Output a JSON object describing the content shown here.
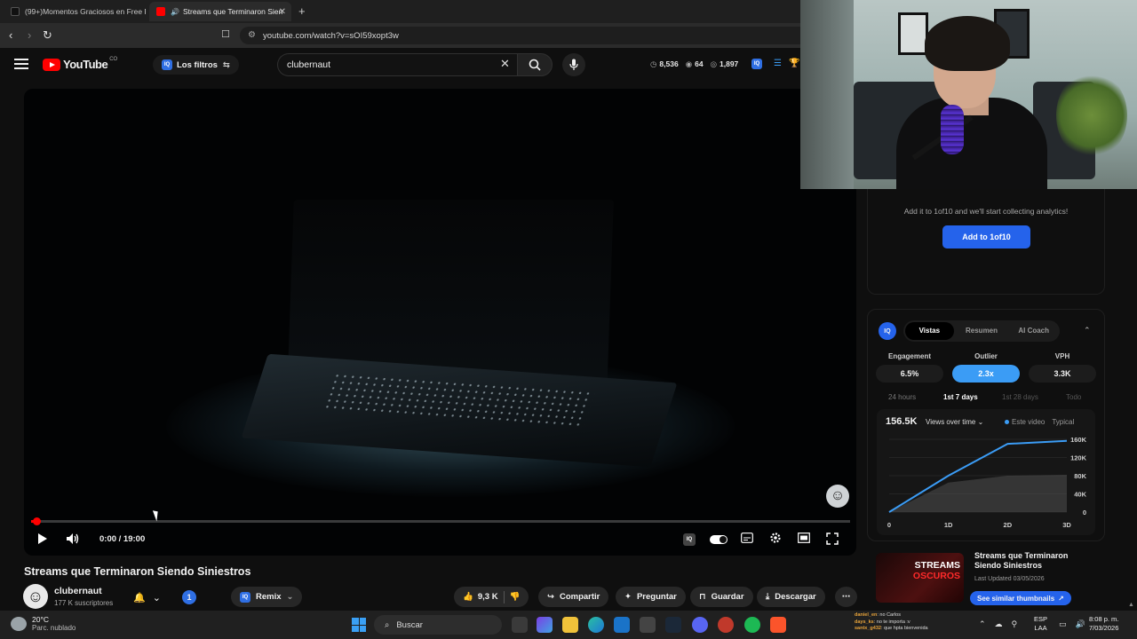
{
  "browser": {
    "tabs": [
      {
        "label": "(99+)Momentos Graciosos en Free F",
        "favicon": "tiktok-icon"
      },
      {
        "label": "Streams que Terminaron Sien",
        "favicon": "youtube-icon",
        "active": true
      }
    ],
    "url": "youtube.com/watch?v=sOI59xopt3w"
  },
  "header": {
    "logo_text": "YouTube",
    "logo_country": "CO",
    "filters_label": "Los filtros",
    "search_value": "clubernaut",
    "stats": {
      "views": "8,536",
      "likes": "64",
      "comments": "1,897"
    }
  },
  "player": {
    "time_label": "0:00 / 19:00",
    "progress_fraction": 0.005
  },
  "video": {
    "title": "Streams que Terminaron Siendo Siniestros",
    "channel": "clubernaut",
    "subscribers": "177 K suscriptores",
    "notif_count": "1",
    "remix_label": "Remix",
    "likes": "9,3 K",
    "share_label": "Compartir",
    "ask_label": "Preguntar",
    "save_label": "Guardar",
    "download_label": "Descargar"
  },
  "panel": {
    "collect_text": "Add it to 1of10 and we'll start collecting analytics!",
    "add_button": "Add to 1of10",
    "iq_badge": "IQ",
    "tabs": [
      "Vistas",
      "Resumen",
      "AI Coach"
    ],
    "metrics": [
      {
        "label": "Engagement",
        "value": "6.5%"
      },
      {
        "label": "Outlier",
        "value": "2.3x"
      },
      {
        "label": "VPH",
        "value": "3.3K"
      }
    ],
    "periods": [
      "24 hours",
      "1st 7 days",
      "1st 28 days",
      "Todo"
    ],
    "big_number": "156.5K",
    "dropdown_label": "Views over time",
    "legend": [
      "Este video",
      "Typical"
    ],
    "similar": {
      "thumb_line1": "STREAMS",
      "thumb_line2": "OSCUROS",
      "title": "Streams que Terminaron Siendo Siniestros",
      "date": "Last Updated 03/05/2026",
      "button": "See similar thumbnails"
    }
  },
  "chart_data": {
    "type": "line",
    "x": [
      "0",
      "1D",
      "2D",
      "3D"
    ],
    "y_ticks": [
      "0",
      "40K",
      "80K",
      "120K",
      "160K"
    ],
    "ylim": [
      0,
      160000
    ],
    "series": [
      {
        "name": "Este video",
        "color": "#3b9cf5",
        "values": [
          0,
          80000,
          150000,
          156500
        ]
      },
      {
        "name": "Typical",
        "color": "#5a5a5a",
        "values": [
          0,
          65000,
          80000,
          82000
        ]
      }
    ]
  },
  "taskbar": {
    "temp": "20°C",
    "weather": "Parc. nublado",
    "search_label": "Buscar",
    "chat": [
      {
        "user": "daniel_en",
        "msg": ": no Carlos"
      },
      {
        "user": "days_ks",
        "msg": ": no te importa :v"
      },
      {
        "user": "santx_g432",
        "msg": ": que hpta bienvenida"
      }
    ],
    "lang_1": "ESP",
    "lang_2": "LAA",
    "time": "8:08 p. m.",
    "date": "7/03/2026"
  }
}
